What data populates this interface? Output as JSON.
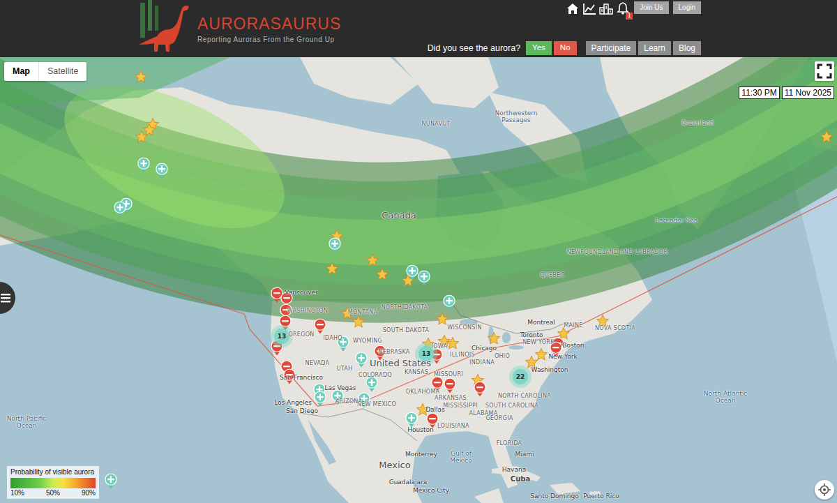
{
  "header": {
    "logo": {
      "title": "AURORASAURUS",
      "tagline": "Reporting Auroras From the Ground Up"
    },
    "notification_count": "1",
    "account_buttons": [
      "Join Us",
      "Login"
    ],
    "question": "Did you see the aurora?",
    "answers": [
      {
        "label": "Yes",
        "color": "#5cb85c"
      },
      {
        "label": "No",
        "color": "#e2574c"
      }
    ],
    "nav": [
      "Participate",
      "Learn",
      "Blog"
    ]
  },
  "map": {
    "view_toggle": [
      {
        "label": "Map",
        "selected": true
      },
      {
        "label": "Satellite",
        "selected": false
      }
    ],
    "time": "11:30 PM",
    "date": "11 Nov 2025",
    "legend": {
      "title": "Probability of visible aurora",
      "ticks": [
        "10%",
        "50%",
        "90%"
      ]
    },
    "labels": [
      {
        "text": "NUNAVUT",
        "kind": "region"
      },
      {
        "text": "Northwestern Passages",
        "kind": "water"
      },
      {
        "text": "Greenland",
        "kind": "land"
      },
      {
        "text": "Canada",
        "kind": "country"
      },
      {
        "text": "Labrador Sea",
        "kind": "water"
      },
      {
        "text": "NEWFOUNDLAND AND LABRADOR",
        "kind": "region"
      },
      {
        "text": "QUEBEC",
        "kind": "region"
      },
      {
        "text": "NORTH DAKOTA",
        "kind": "region"
      },
      {
        "text": "SOUTH DAKOTA",
        "kind": "region"
      },
      {
        "text": "WISCONSIN",
        "kind": "region"
      },
      {
        "text": "Montreal",
        "kind": "city"
      },
      {
        "text": "Toronto",
        "kind": "city"
      },
      {
        "text": "NEW YORK",
        "kind": "region"
      },
      {
        "text": "MAINE",
        "kind": "region"
      },
      {
        "text": "NOVA SCOTIA",
        "kind": "region"
      },
      {
        "text": "Boston",
        "kind": "city"
      },
      {
        "text": "New York",
        "kind": "city"
      },
      {
        "text": "Washington",
        "kind": "city"
      },
      {
        "text": "NORTH CAROLINA",
        "kind": "region"
      },
      {
        "text": "SOUTH CAROLINA",
        "kind": "region"
      },
      {
        "text": "GEORGIA",
        "kind": "region"
      },
      {
        "text": "ALABAMA",
        "kind": "region"
      },
      {
        "text": "MISSISSIPPI",
        "kind": "region"
      },
      {
        "text": "LOUISIANA",
        "kind": "region"
      },
      {
        "text": "ARKANSAS",
        "kind": "region"
      },
      {
        "text": "INDIANA",
        "kind": "region"
      },
      {
        "text": "OHIO",
        "kind": "region"
      },
      {
        "text": "ILLINOIS",
        "kind": "region"
      },
      {
        "text": "Chicago",
        "kind": "city"
      },
      {
        "text": "IOWA",
        "kind": "region"
      },
      {
        "text": "MISSOURI",
        "kind": "region"
      },
      {
        "text": "KANSAS",
        "kind": "region"
      },
      {
        "text": "NEBRASKA",
        "kind": "region"
      },
      {
        "text": "OKLAHOMA",
        "kind": "region"
      },
      {
        "text": "Dallas",
        "kind": "city"
      },
      {
        "text": "Houston",
        "kind": "city"
      },
      {
        "text": "NEW MEXICO",
        "kind": "region"
      },
      {
        "text": "ARIZONA",
        "kind": "region"
      },
      {
        "text": "Las Vegas",
        "kind": "city"
      },
      {
        "text": "Los Angeles",
        "kind": "city"
      },
      {
        "text": "San Diego",
        "kind": "city"
      },
      {
        "text": "San Francisco",
        "kind": "city"
      },
      {
        "text": "NEVADA",
        "kind": "region"
      },
      {
        "text": "UTAH",
        "kind": "region"
      },
      {
        "text": "COLORADO",
        "kind": "region"
      },
      {
        "text": "WYOMING",
        "kind": "region"
      },
      {
        "text": "IDAHO",
        "kind": "region"
      },
      {
        "text": "OREGON",
        "kind": "region"
      },
      {
        "text": "WASHINGTON",
        "kind": "region"
      },
      {
        "text": "MONTANA",
        "kind": "region"
      },
      {
        "text": "Vancouver",
        "kind": "city"
      },
      {
        "text": "United States",
        "kind": "country"
      },
      {
        "text": "Mexico",
        "kind": "country"
      },
      {
        "text": "Monterrey",
        "kind": "city"
      },
      {
        "text": "Guadalajara",
        "kind": "city"
      },
      {
        "text": "Mexico City",
        "kind": "city"
      },
      {
        "text": "Gulf of Mexico",
        "kind": "water"
      },
      {
        "text": "FLORIDA",
        "kind": "region"
      },
      {
        "text": "Miami",
        "kind": "city"
      },
      {
        "text": "Havana",
        "kind": "city"
      },
      {
        "text": "Cuba",
        "kind": "island"
      },
      {
        "text": "Santo Domingo",
        "kind": "city"
      },
      {
        "text": "Puerto Rico",
        "kind": "city"
      },
      {
        "text": "North Atlantic Ocean",
        "kind": "water"
      },
      {
        "text": "North Pacific Ocean",
        "kind": "water"
      }
    ],
    "reports": [
      {
        "kind": "seen"
      },
      {
        "kind": "seen"
      },
      {
        "kind": "seen"
      },
      {
        "kind": "seen"
      },
      {
        "kind": "seen"
      },
      {
        "kind": "seen"
      },
      {
        "kind": "seen"
      },
      {
        "kind": "seen"
      },
      {
        "kind": "seen"
      },
      {
        "kind": "seen"
      },
      {
        "kind": "seen"
      },
      {
        "kind": "seen"
      },
      {
        "kind": "seen"
      },
      {
        "kind": "seen"
      },
      {
        "kind": "seen"
      },
      {
        "kind": "seen"
      },
      {
        "kind": "seen"
      },
      {
        "kind": "seen"
      },
      {
        "kind": "seen"
      },
      {
        "kind": "seen"
      },
      {
        "kind": "seen"
      },
      {
        "kind": "seen"
      },
      {
        "kind": "seen"
      },
      {
        "kind": "unseen"
      },
      {
        "kind": "unseen"
      },
      {
        "kind": "unseen"
      },
      {
        "kind": "unseen"
      },
      {
        "kind": "unseen"
      },
      {
        "kind": "unseen"
      },
      {
        "kind": "unseen"
      },
      {
        "kind": "unseen"
      },
      {
        "kind": "unseen"
      },
      {
        "kind": "unseen"
      },
      {
        "kind": "unseen"
      },
      {
        "kind": "unseen"
      },
      {
        "kind": "unseen"
      },
      {
        "kind": "unseen"
      },
      {
        "kind": "unseen"
      },
      {
        "kind": "unseen"
      },
      {
        "kind": "tweet"
      },
      {
        "kind": "tweet"
      },
      {
        "kind": "tweet"
      },
      {
        "kind": "tweet"
      },
      {
        "kind": "tweet"
      },
      {
        "kind": "tweet"
      },
      {
        "kind": "tweet"
      },
      {
        "kind": "tweet"
      },
      {
        "kind": "tweet"
      },
      {
        "kind": "tweet"
      },
      {
        "kind": "tweet"
      },
      {
        "kind": "tweet"
      },
      {
        "kind": "tweet"
      },
      {
        "kind": "tweet"
      },
      {
        "kind": "tweet"
      },
      {
        "kind": "tweet"
      },
      {
        "kind": "tweet"
      }
    ],
    "clusters": [
      {
        "count": "13"
      },
      {
        "count": "13"
      },
      {
        "count": "22"
      }
    ]
  }
}
